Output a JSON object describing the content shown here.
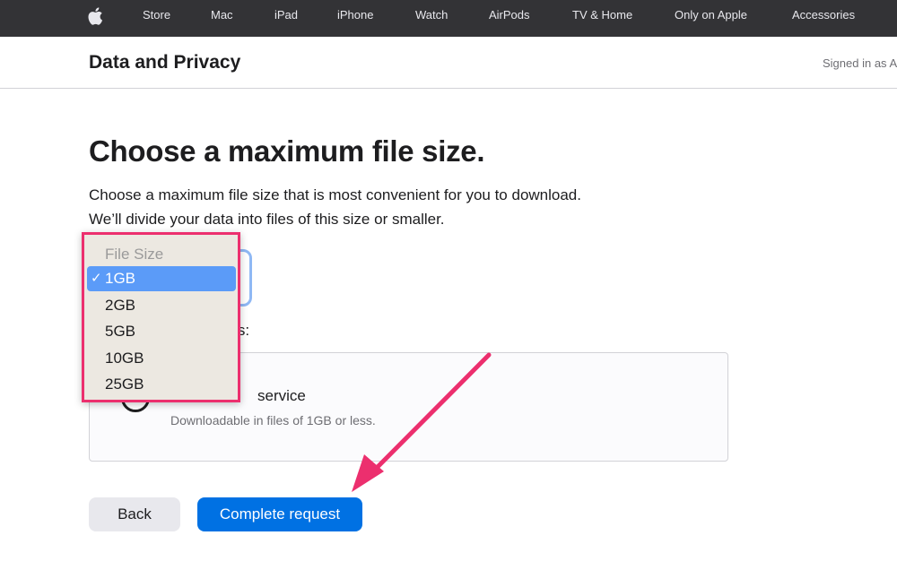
{
  "globalnav": {
    "apple_logo": "apple-logo-icon",
    "items": [
      "Store",
      "Mac",
      "iPad",
      "iPhone",
      "Watch",
      "AirPods",
      "TV & Home",
      "Only on Apple",
      "Accessories"
    ]
  },
  "subnav": {
    "title": "Data and Privacy",
    "signed_in": "Signed in as A"
  },
  "main": {
    "heading": "Choose a maximum file size.",
    "description_line1": "Choose a maximum file size that is most convenient for you to download.",
    "description_line2": "We’ll divide your data into files of this size or smaller.",
    "options_label_partial": "ons:",
    "option": {
      "title_partial": "service",
      "subtitle": "Downloadable in files of 1GB or less."
    }
  },
  "dropdown": {
    "header": "File Size",
    "selected_value": "1GB",
    "check_mark": "✓",
    "options": [
      "1GB",
      "2GB",
      "5GB",
      "10GB",
      "25GB"
    ]
  },
  "buttons": {
    "back": "Back",
    "complete": "Complete request"
  },
  "colors": {
    "nav_bg": "#333336",
    "accent": "#0071e3",
    "highlight": "#ec2f6e",
    "selected_option": "#5b9bf8"
  }
}
